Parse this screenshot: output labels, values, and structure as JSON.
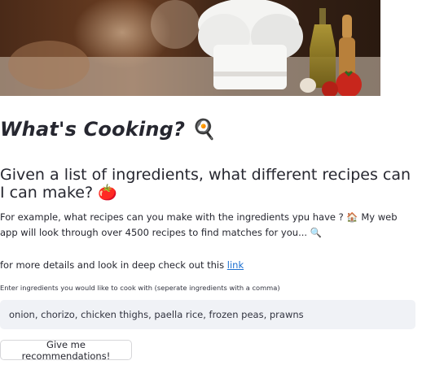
{
  "header": {
    "title": "What's Cooking?",
    "title_emoji": "🍳"
  },
  "intro": {
    "subtitle": "Given a list of ingredients, what different recipes can I can make?",
    "subtitle_emoji": "🍅",
    "description": "For example, what recipes can you make with the ingredients ypu have ? 🏠 My web app will look through over 4500 recipes to find matches for you... 🔍"
  },
  "details": {
    "text": "for more details and look in deep check out this",
    "link_label": "link"
  },
  "ingredients_input": {
    "label": "Enter ingredients you would like to cook with (seperate ingredients with a comma)",
    "value": "onion, chorizo, chicken thighs, paella rice, frozen peas, prawns"
  },
  "submit": {
    "label": "Give me recommendations!"
  },
  "colors": {
    "link": "#1c6fd0",
    "input_bg": "#f0f2f6",
    "text": "#262730"
  }
}
